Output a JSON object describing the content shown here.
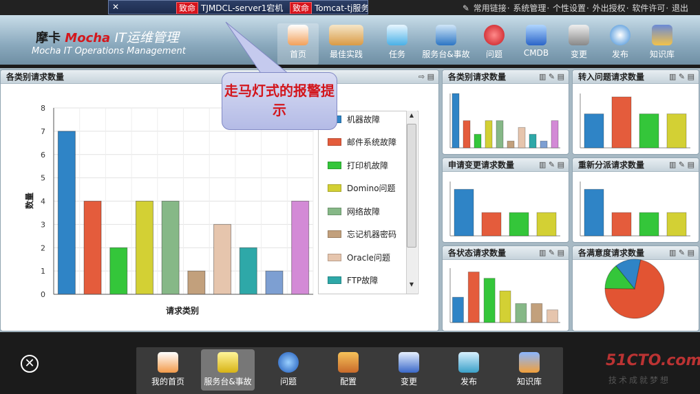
{
  "alarm_ticker": {
    "items": [
      {
        "level": "致命",
        "text": "TJMDCL-server1宕机"
      },
      {
        "level": "致命",
        "text": "Tomcat-tj服务"
      }
    ]
  },
  "top_links": [
    "常用链接",
    "系统管理",
    "个性设置",
    "外出授权",
    "软件许可",
    "退出"
  ],
  "logo": {
    "brand_cn": "摩卡",
    "brand_en": "Mocha",
    "system": "IT运维管理",
    "subtitle": "Mocha IT Operations Management"
  },
  "nav": [
    "首页",
    "最佳实践",
    "任务",
    "服务台&事故",
    "问题",
    "CMDB",
    "变更",
    "发布",
    "知识库"
  ],
  "nav_active": "首页",
  "callout": "走马灯式的报警提示",
  "main_panel": {
    "title": "各类别请求数量"
  },
  "small_panels": [
    {
      "title": "各类别请求数量"
    },
    {
      "title": "转入问题请求数量"
    },
    {
      "title": "申请变更请求数量"
    },
    {
      "title": "重新分派请求数量"
    },
    {
      "title": "各状态请求数量"
    },
    {
      "title": "各满意度请求数量"
    }
  ],
  "dock": [
    "我的首页",
    "服务台&事故",
    "问题",
    "配置",
    "变更",
    "发布",
    "知识库"
  ],
  "dock_active": "服务台&事故",
  "watermark": {
    "main": "51CTO.com",
    "sub": "技术成就梦想"
  },
  "chart_data": {
    "type": "bar",
    "xlabel": "请求类别",
    "ylabel": "数量",
    "ylim": [
      0,
      8
    ],
    "yticks": [
      0,
      1,
      2,
      3,
      4,
      5,
      6,
      7,
      8
    ],
    "series": [
      {
        "name": "机器故障",
        "value": 7,
        "color": "#2f84c6"
      },
      {
        "name": "邮件系统故障",
        "value": 4,
        "color": "#e45c3c"
      },
      {
        "name": "打印机故障",
        "value": 2,
        "color": "#34c63a"
      },
      {
        "name": "Domino问题",
        "value": 4,
        "color": "#d3d034"
      },
      {
        "name": "网络故障",
        "value": 4,
        "color": "#86b887"
      },
      {
        "name": "忘记机器密码",
        "value": 1,
        "color": "#c2a07c"
      },
      {
        "name": "Oracle问题",
        "value": 3,
        "color": "#e6c5ad"
      },
      {
        "name": "FTP故障",
        "value": 2,
        "color": "#2ea8a8"
      },
      {
        "name": "",
        "value": 1,
        "color": "#7d9fd2"
      },
      {
        "name": "",
        "value": 4,
        "color": "#d38ad6"
      }
    ],
    "legend_visible": [
      "机器故障",
      "邮件系统故障",
      "打印机故障",
      "Domino问题",
      "网络故障",
      "忘记机器密码",
      "Oracle问题",
      "FTP故障"
    ],
    "mini": {
      "category": [
        8,
        4,
        2,
        4,
        4,
        1,
        3,
        2,
        1,
        4
      ],
      "to_problem": [
        2,
        3,
        2,
        2
      ],
      "change": [
        3,
        1.5,
        1.5,
        1.5
      ],
      "reassign": [
        3,
        1.5,
        1.5,
        1.5
      ],
      "status": [
        2,
        4,
        3.5,
        2.5,
        1.5,
        1.5,
        1
      ],
      "satisfaction_pie": [
        0.72,
        0.14,
        0.14
      ]
    }
  },
  "colors": {
    "alarm_red": "#d8141c",
    "callout_text": "#d3161c"
  }
}
